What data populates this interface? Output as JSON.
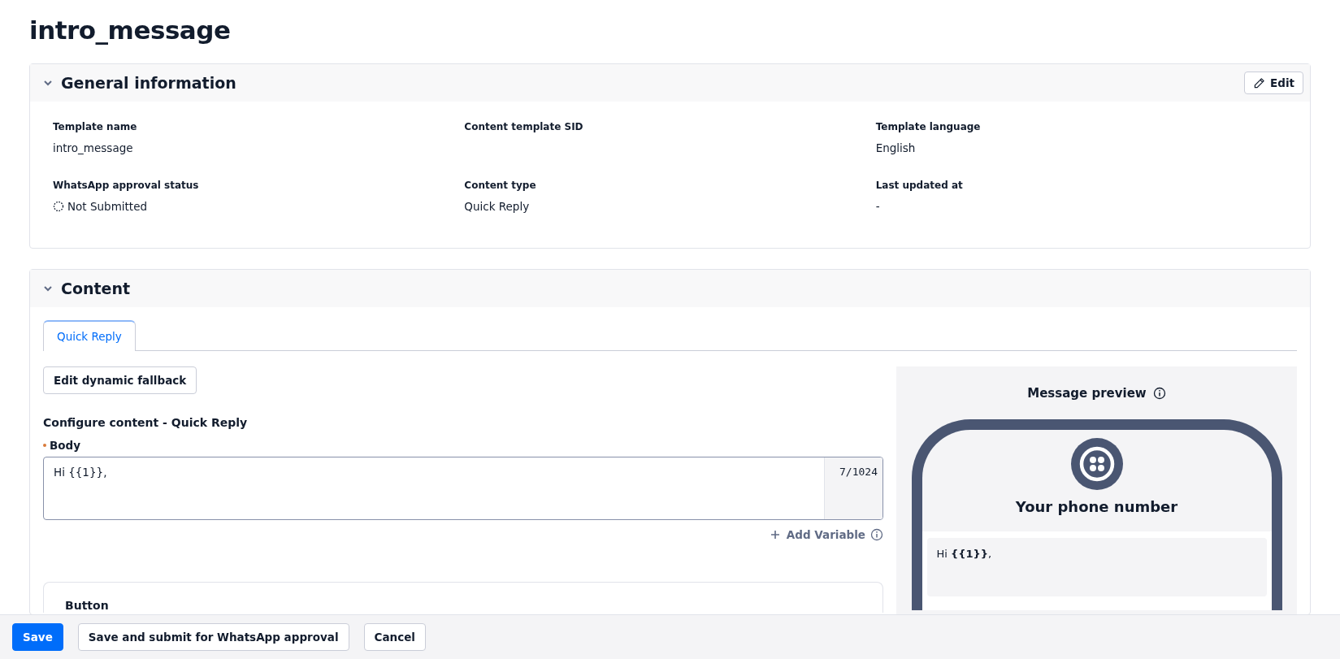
{
  "page_title": "intro_message",
  "general_information": {
    "title": "General information",
    "expanded": true,
    "edit_button": "Edit",
    "fields": [
      {
        "label": "Template name",
        "value": "intro_message",
        "kind": "text"
      },
      {
        "label": "Content template SID",
        "kind": "text"
      },
      {
        "label": "Template language",
        "value": "English",
        "kind": "text"
      },
      {
        "label": "WhatsApp approval status",
        "value": "Not Submitted",
        "kind": "status"
      },
      {
        "label": "Content type",
        "value": "Quick Reply",
        "kind": "text"
      },
      {
        "label": "Last updated at",
        "value": "-",
        "kind": "text"
      }
    ]
  },
  "content": {
    "title": "Content",
    "expanded": true,
    "tabs": [
      {
        "label": "Quick Reply",
        "selected": true
      }
    ],
    "fallback_button": "Edit dynamic fallback",
    "configure_heading": "Configure content - Quick Reply",
    "body": {
      "label": "Body",
      "required": true,
      "value": "Hi {{1}},",
      "counter": "7/1024"
    },
    "add_variable": "Add Variable",
    "button_section": {
      "title": "Button"
    },
    "preview": {
      "title": "Message preview",
      "sender": "Your phone number",
      "message": "Hi **{{1}}**,"
    }
  },
  "footer": {
    "buttons": [
      {
        "label": "Save",
        "kind": "primary"
      },
      {
        "label": "Save and submit for WhatsApp approval",
        "kind": "secondary"
      },
      {
        "label": "Cancel",
        "kind": "secondary"
      }
    ]
  }
}
